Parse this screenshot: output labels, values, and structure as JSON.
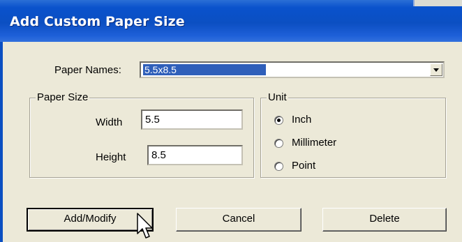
{
  "dialog": {
    "title": "Add Custom Paper Size"
  },
  "paper_names": {
    "label": "Paper Names:",
    "selected_value": "5.5x8.5"
  },
  "paper_size": {
    "group_title": "Paper Size",
    "width_label": "Width",
    "width_value": "5.5",
    "height_label": "Height",
    "height_value": "8.5"
  },
  "unit": {
    "group_title": "Unit",
    "options": [
      {
        "label": "Inch",
        "selected": true
      },
      {
        "label": "Millimeter",
        "selected": false
      },
      {
        "label": "Point",
        "selected": false
      }
    ]
  },
  "buttons": {
    "add_modify": "Add/Modify",
    "cancel": "Cancel",
    "delete": "Delete"
  },
  "icons": {
    "dropdown": "chevron-down-icon",
    "cursor": "mouse-pointer-icon"
  },
  "colors": {
    "titlebar": "#0b4fc2",
    "selection": "#2f5fba",
    "dialog_bg": "#ece9d8"
  }
}
